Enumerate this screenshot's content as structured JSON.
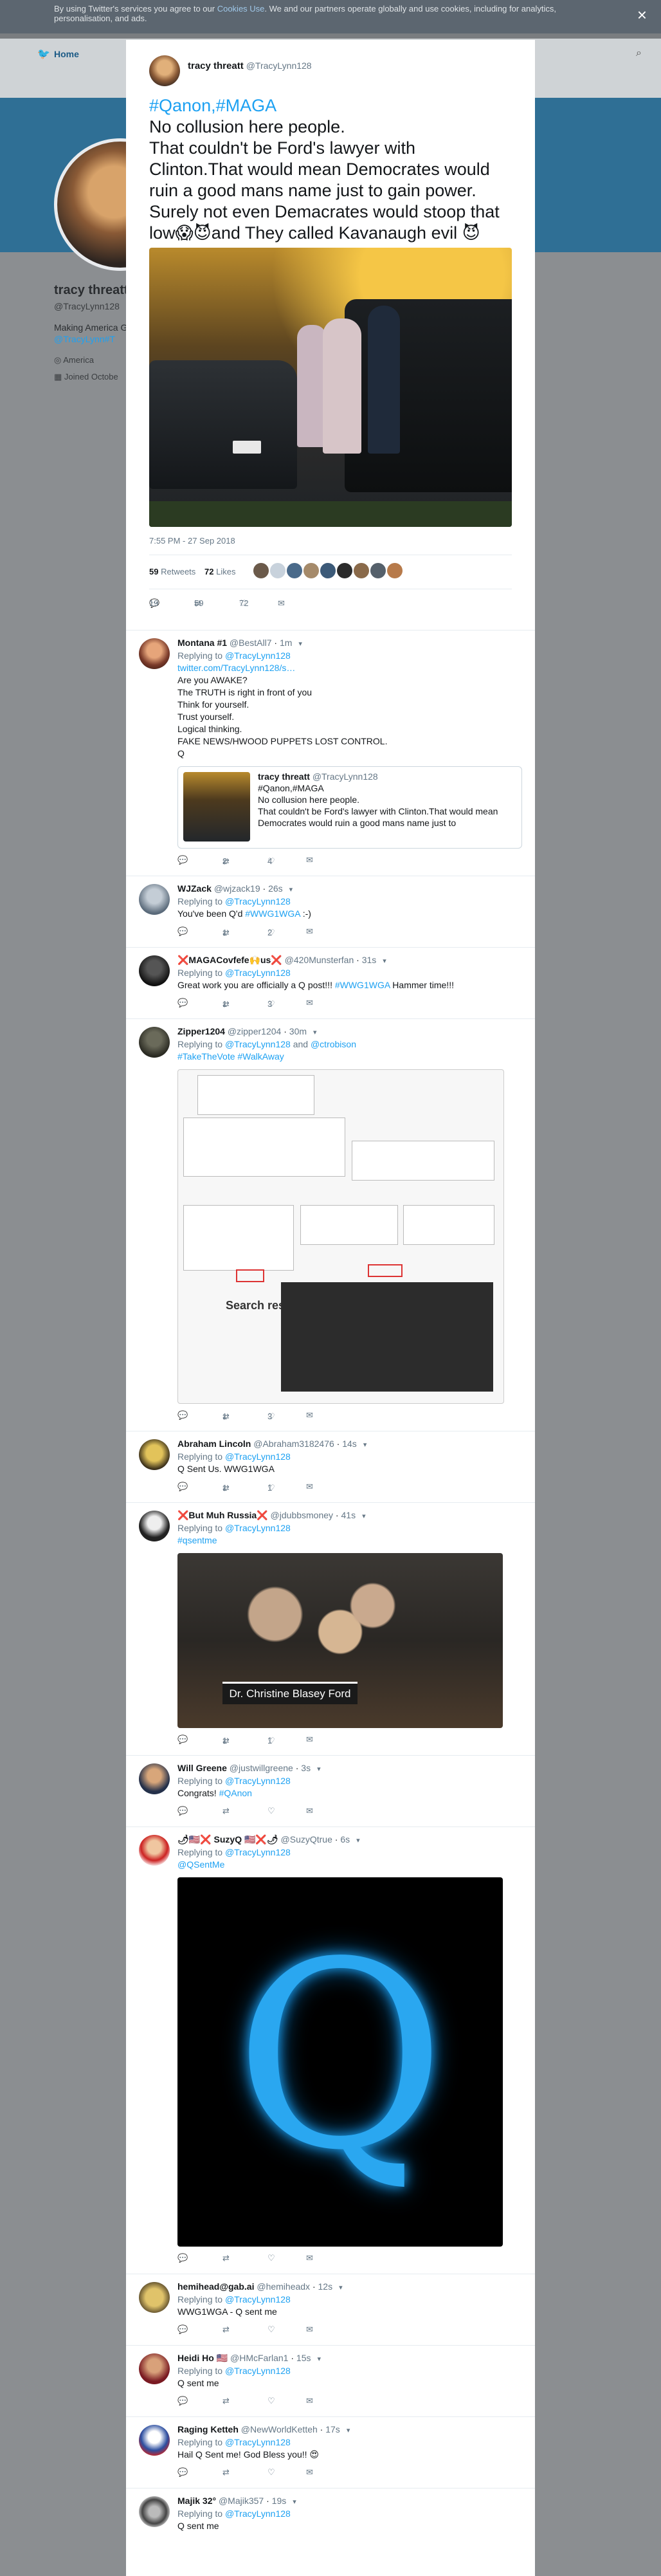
{
  "cookie": {
    "text_before": "By using Twitter's services you agree to our ",
    "link": "Cookies Use",
    "text_after": ". We and our partners operate globally and use cookies, including for analytics, personalisation, and ads.",
    "close": "×"
  },
  "nav": {
    "home": "Home",
    "icons": [
      "bird-icon",
      "search-icon"
    ]
  },
  "profile": {
    "name": "tracy threatt",
    "handle": "@TracyLynn128",
    "bio": "Making America G",
    "bio_link": "@TracyLynn#T",
    "location": "America",
    "joined": "Joined Octobe"
  },
  "tweet": {
    "name": "tracy threatt",
    "handle": "@TracyLynn128",
    "hashtags": "#Qanon,#MAGA",
    "lines": [
      "No collusion here people.",
      "That couldn't be Ford's lawyer with Clinton.That would mean Democrates would ruin a good mans name just to gain power.",
      "Surely not even Demacrates would stoop that low😱😈and They called Kavanaugh evil 😈"
    ],
    "timestamp": "7:55 PM - 27 Sep 2018",
    "retweets": "59",
    "retweets_label": "Retweets",
    "likes": "72",
    "likes_label": "Likes",
    "actions": {
      "reply": "19",
      "retweet": "59",
      "like": "72"
    }
  },
  "replies": [
    {
      "name": "Montana #1",
      "handle": "@BestAll7",
      "time": "1m",
      "replying_to": "@TracyLynn128",
      "link": "twitter.com/TracyLynn128/s…",
      "text": "Are you AWAKE?\nThe TRUTH is right in front of you\nThink for yourself.\nTrust yourself.\nLogical thinking.\nFAKE NEWS/HWOOD PUPPETS LOST CONTROL.\nQ",
      "quote": {
        "name": "tracy threatt",
        "handle": "@TracyLynn128",
        "line1": "#Qanon,#MAGA",
        "line2": "No collusion here people.",
        "line3": "That couldn't be Ford's lawyer with Clinton.That would mean Democrates would ruin a good mans name just to"
      },
      "actions": {
        "reply": "",
        "retweet": "2",
        "like": "4"
      }
    },
    {
      "name": "WJZack",
      "handle": "@wjzack19",
      "time": "26s",
      "replying_to": "@TracyLynn128",
      "text_before": "You've been Q'd ",
      "tag": "#WWG1WGA",
      "text_after": " :-)",
      "actions": {
        "reply": "",
        "retweet": "1",
        "like": "2"
      }
    },
    {
      "name": "❌MAGACovfefe🙌us❌",
      "handle": "@420Munsterfan",
      "time": "31s",
      "replying_to": "@TracyLynn128",
      "text_before": "Great work you are officially a Q post!!! ",
      "tag": "#WWG1WGA",
      "text_after": " Hammer time!!!",
      "actions": {
        "reply": "",
        "retweet": "1",
        "like": "3"
      }
    },
    {
      "name": "Zipper1204",
      "handle": "@zipper1204",
      "time": "30m",
      "replying_to": "@TracyLynn128",
      "replying_to_2": "@ctrobison",
      "tags": "#TakeTheVote #WalkAway",
      "media_text": "Search results for",
      "actions": {
        "reply": "",
        "retweet": "1",
        "like": "3"
      }
    },
    {
      "name": "Abraham Lincoln",
      "handle": "@Abraham3182476",
      "time": "14s",
      "replying_to": "@TracyLynn128",
      "text": "Q Sent Us. WWG1WGA",
      "actions": {
        "reply": "",
        "retweet": "1",
        "like": "1"
      }
    },
    {
      "name": "❌But Muh Russia❌",
      "handle": "@jdubbsmoney",
      "time": "41s",
      "replying_to": "@TracyLynn128",
      "tag": "#qsentme",
      "caption": "Dr. Christine Blasey Ford",
      "actions": {
        "reply": "",
        "retweet": "1",
        "like": "1"
      }
    },
    {
      "name": "Will Greene",
      "handle": "@justwillgreene",
      "time": "3s",
      "replying_to": "@TracyLynn128",
      "text_before": "Congrats! ",
      "tag": "#QAnon",
      "actions": {
        "reply": "",
        "retweet": "",
        "like": ""
      }
    },
    {
      "name": "🌶🇺🇸❌ SuzyQ 🇺🇸❌🌶",
      "handle": "@SuzyQtrue",
      "time": "6s",
      "replying_to": "@TracyLynn128",
      "tag": "@QSentMe",
      "media_glyph": "Q",
      "actions": {
        "reply": "",
        "retweet": "",
        "like": ""
      }
    },
    {
      "name": "hemihead@gab.ai",
      "handle": "@hemiheadx",
      "time": "12s",
      "replying_to": "@TracyLynn128",
      "text": "WWG1WGA - Q sent me",
      "actions": {
        "reply": "",
        "retweet": "",
        "like": ""
      }
    },
    {
      "name": "Heidi Ho 🇺🇸",
      "handle": "@HMcFarlan1",
      "time": "15s",
      "replying_to": "@TracyLynn128",
      "text": "Q sent me",
      "actions": {
        "reply": "",
        "retweet": "",
        "like": ""
      }
    },
    {
      "name": "Raging Ketteh",
      "handle": "@NewWorldKetteh",
      "time": "17s",
      "replying_to": "@TracyLynn128",
      "text": "Hail Q Sent me! God Bless you!! 😍",
      "actions": {
        "reply": "",
        "retweet": "",
        "like": ""
      }
    },
    {
      "name": "Majik 32°",
      "handle": "@Majik357",
      "time": "19s",
      "replying_to": "@TracyLynn128",
      "text": "Q sent me",
      "actions": {
        "reply": "",
        "retweet": "",
        "like": ""
      }
    }
  ],
  "labels": {
    "replying_to": "Replying to ",
    "and": " and "
  },
  "colors": {
    "link": "#1da1f2",
    "muted": "#657786",
    "overlay": "#7a7d80",
    "banner": "#2f6f95"
  }
}
